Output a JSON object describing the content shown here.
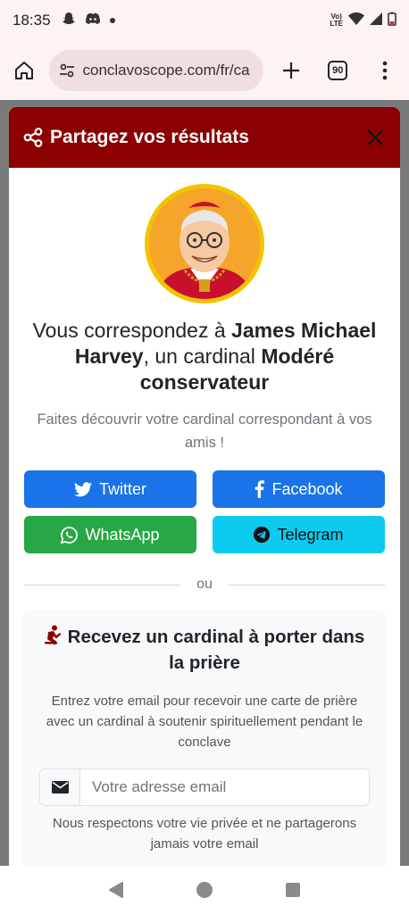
{
  "status_bar": {
    "time": "18:35",
    "network_label": "LTE"
  },
  "browser": {
    "url": "conclavoscope.com/fr/ca",
    "tab_count": "90"
  },
  "modal": {
    "title": "Partagez vos résultats",
    "match": {
      "prefix": "Vous correspondez à ",
      "name": "James Michael Harvey",
      "middle": ", un cardinal ",
      "category": "Modéré conservateur"
    },
    "subtitle": "Faites découvrir votre cardinal correspondant à vos amis !",
    "share_buttons": {
      "twitter": "Twitter",
      "facebook": "Facebook",
      "whatsapp": "WhatsApp",
      "telegram": "Telegram"
    },
    "divider_text": "ou",
    "prayer": {
      "title": "Recevez un cardinal à porter dans la prière",
      "description": "Entrez votre email pour recevoir une carte de prière avec un cardinal à soutenir spirituellement pendant le conclave",
      "email_placeholder": "Votre adresse email",
      "privacy_note": "Nous respectons votre vie privée et ne partagerons jamais votre email"
    }
  },
  "colors": {
    "header_bg": "#8b0000",
    "primary_blue": "#1a73e8",
    "whatsapp_green": "#28a745",
    "telegram_cyan": "#0dcaf0",
    "avatar_ring": "#f2c400"
  }
}
